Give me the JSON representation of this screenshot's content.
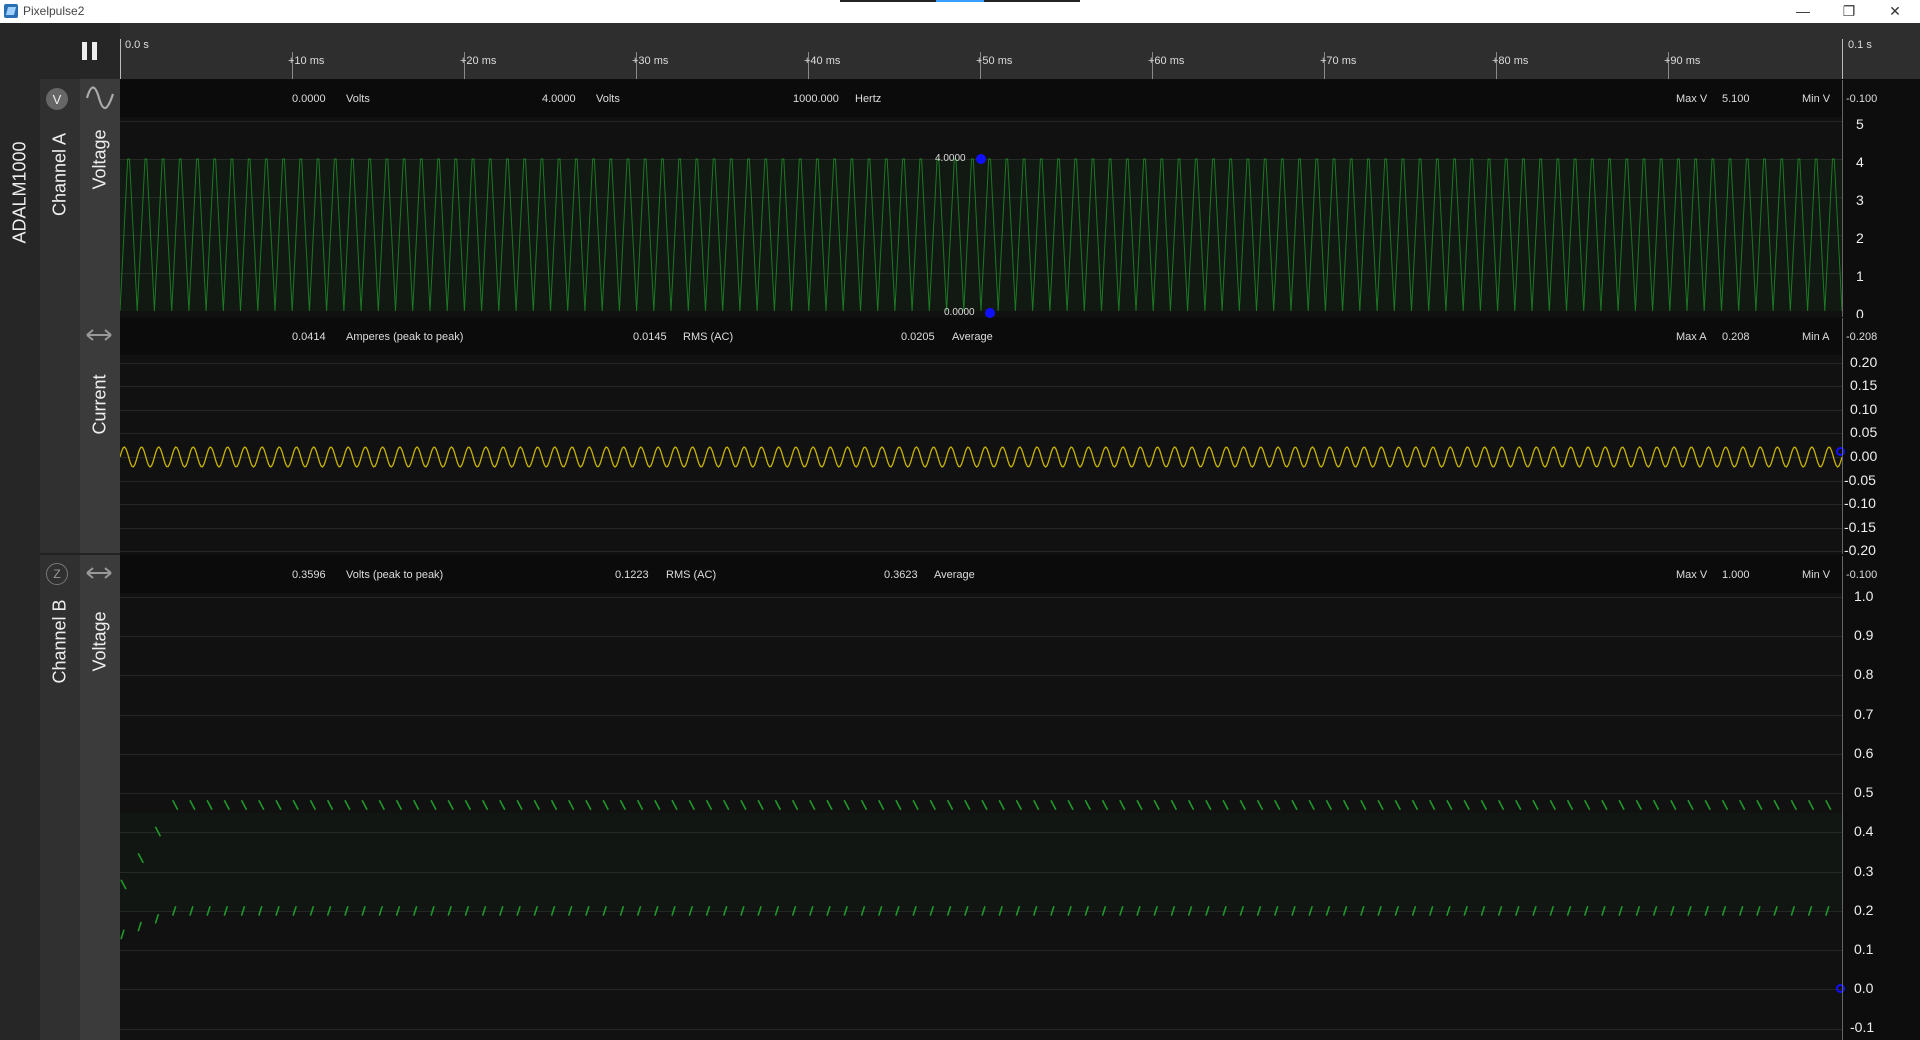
{
  "window": {
    "title": "Pixelpulse2",
    "minimize": "—",
    "restore": "❐",
    "close": "✕"
  },
  "toolbar": {
    "settings_icon": "gear-icon",
    "pause_icon": "pause-icon"
  },
  "device": {
    "name": "ADALM1000"
  },
  "timeline": {
    "start": "0.0 s",
    "end": "0.1 s",
    "ticks": [
      "+10 ms",
      "+20 ms",
      "+30 ms",
      "+40 ms",
      "+50 ms",
      "+60 ms",
      "+70 ms",
      "+80 ms",
      "+90 ms"
    ]
  },
  "channel_a": {
    "label": "Channel A",
    "mode_badge": "V",
    "voltage": {
      "label": "Voltage",
      "stats": [
        {
          "value": "0.0000",
          "unit": "Volts"
        },
        {
          "value": "4.0000",
          "unit": "Volts"
        },
        {
          "value": "1000.000",
          "unit": "Hertz"
        }
      ],
      "max_label": "Max V",
      "max_value": "5.100",
      "min_label": "Min V",
      "min_value": "-0.100",
      "axis_ticks": [
        "5",
        "4",
        "3",
        "2",
        "1",
        "0"
      ],
      "marker_high": "4.0000",
      "marker_low": "0.0000"
    },
    "current": {
      "label": "Current",
      "stats": [
        {
          "value": "0.0414",
          "unit": "Amperes (peak to peak)"
        },
        {
          "value": "0.0145",
          "unit": "RMS (AC)"
        },
        {
          "value": "0.0205",
          "unit": "Average"
        }
      ],
      "max_label": "Max A",
      "max_value": "0.208",
      "min_label": "Min A",
      "min_value": "-0.208",
      "axis_ticks": [
        "0.20",
        "0.15",
        "0.10",
        "0.05",
        "0.00",
        "-0.05",
        "-0.10",
        "-0.15",
        "-0.20"
      ]
    }
  },
  "channel_b": {
    "label": "Channel B",
    "mode_badge": "Z",
    "voltage": {
      "label": "Voltage",
      "stats": [
        {
          "value": "0.3596",
          "unit": "Volts (peak to peak)"
        },
        {
          "value": "0.1223",
          "unit": "RMS (AC)"
        },
        {
          "value": "0.3623",
          "unit": "Average"
        }
      ],
      "max_label": "Max V",
      "max_value": "1.000",
      "min_label": "Min V",
      "min_value": "-0.100",
      "axis_ticks": [
        "1.0",
        "0.9",
        "0.8",
        "0.7",
        "0.6",
        "0.5",
        "0.4",
        "0.3",
        "0.2",
        "0.1",
        "0.0",
        "-0.1"
      ]
    }
  },
  "colors": {
    "voltage_trace": "#1f9a2a",
    "current_trace": "#c8b400",
    "marker": "#1010ff"
  }
}
